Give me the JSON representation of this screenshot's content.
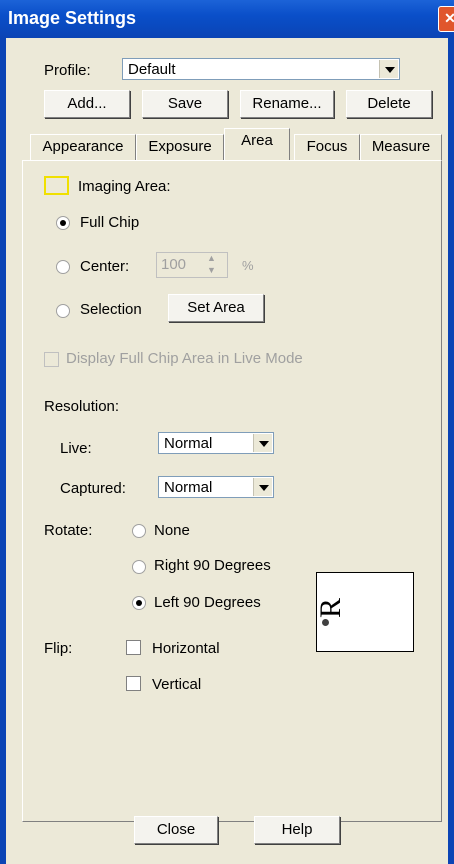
{
  "window": {
    "title": "Image Settings"
  },
  "profile": {
    "label": "Profile:",
    "value": "Default"
  },
  "buttons": {
    "add": "Add...",
    "save": "Save",
    "rename": "Rename...",
    "delete": "Delete"
  },
  "tabs": [
    "Appearance",
    "Exposure",
    "Area",
    "Focus",
    "Measure"
  ],
  "imaging": {
    "label": "Imaging Area:",
    "full_chip": "Full Chip",
    "center": "Center:",
    "center_value": "100",
    "center_unit": "%",
    "selection": "Selection",
    "set_area": "Set Area",
    "display_full_chip": "Display Full Chip Area in Live Mode"
  },
  "resolution": {
    "label": "Resolution:",
    "live_label": "Live:",
    "live_value": "Normal",
    "captured_label": "Captured:",
    "captured_value": "Normal"
  },
  "rotate": {
    "label": "Rotate:",
    "none": "None",
    "right": "Right 90 Degrees",
    "left": "Left 90 Degrees",
    "preview_letter": "R"
  },
  "flip": {
    "label": "Flip:",
    "horizontal": "Horizontal",
    "vertical": "Vertical"
  },
  "footer": {
    "close": "Close",
    "help": "Help"
  }
}
